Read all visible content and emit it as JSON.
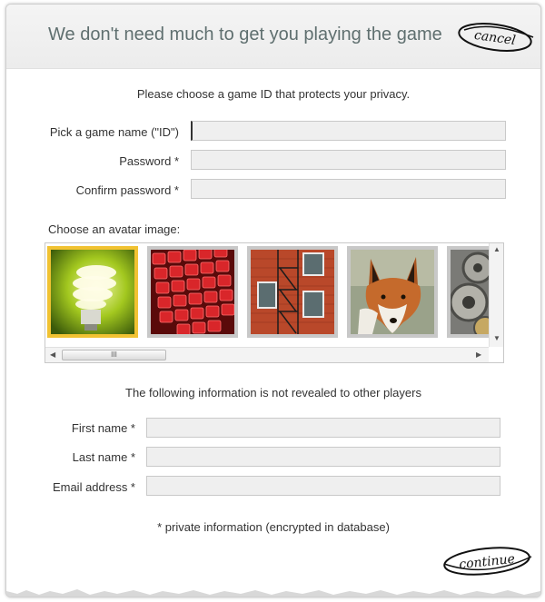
{
  "header": {
    "title": "We don't need much to get you playing the game"
  },
  "buttons": {
    "cancel": "cancel",
    "continue": "continue"
  },
  "game_id_section": {
    "intro": "Please choose a game ID that protects your privacy.",
    "fields": [
      {
        "label": "Pick a game name (\"ID\")",
        "value": "",
        "focused": true
      },
      {
        "label": "Password *",
        "value": ""
      },
      {
        "label": "Confirm password *",
        "value": ""
      }
    ]
  },
  "avatar_section": {
    "label": "Choose an avatar image:",
    "images": [
      {
        "name": "light-bulb",
        "selected": true
      },
      {
        "name": "red-keyboard",
        "selected": false
      },
      {
        "name": "fire-escape-building",
        "selected": false
      },
      {
        "name": "fox",
        "selected": false
      },
      {
        "name": "clockwork-gears",
        "selected": false
      }
    ],
    "scrollbar_grip": "III"
  },
  "private_section": {
    "note": "The following information is not revealed to other players",
    "fields": [
      {
        "label": "First name *",
        "value": ""
      },
      {
        "label": "Last name *",
        "value": ""
      },
      {
        "label": "Email address *",
        "value": ""
      }
    ],
    "footnote": "* private information (encrypted in database)"
  },
  "colors": {
    "selected_border": "#f1c232",
    "field_bg": "#efefef",
    "header_text": "#5f6f6f"
  }
}
